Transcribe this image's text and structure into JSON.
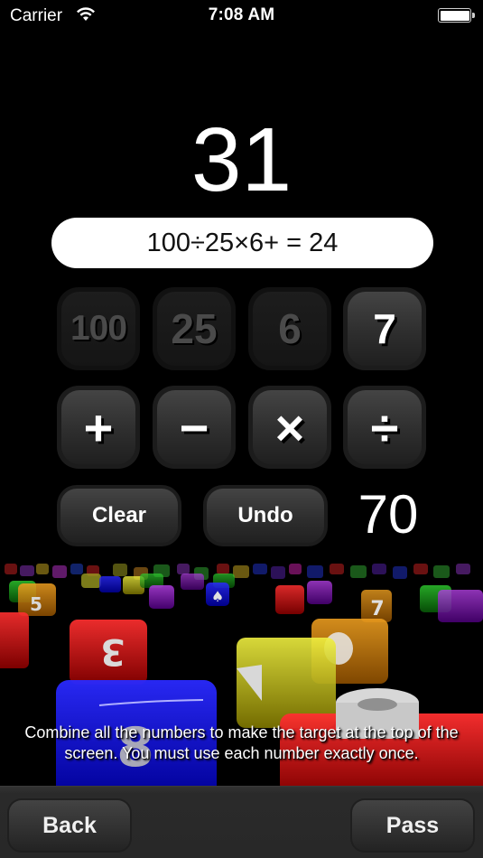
{
  "status_bar": {
    "carrier": "Carrier",
    "time": "7:08 AM",
    "wifi_icon": "wifi-icon",
    "battery_icon": "battery-full-icon"
  },
  "game": {
    "target": "31",
    "expression": "100÷25×6+ = 24",
    "number_tiles": [
      {
        "label": "100",
        "state": "used"
      },
      {
        "label": "25",
        "state": "used"
      },
      {
        "label": "6",
        "state": "used"
      },
      {
        "label": "7",
        "state": "available"
      }
    ],
    "operator_tiles": [
      {
        "label": "+",
        "icon": "plus-icon"
      },
      {
        "label": "−",
        "icon": "minus-icon"
      },
      {
        "label": "×",
        "icon": "multiply-icon"
      },
      {
        "label": "÷",
        "icon": "divide-icon"
      }
    ],
    "clear_label": "Clear",
    "undo_label": "Undo",
    "current_result": "70"
  },
  "instructions": "Combine all the numbers to make the target at the top of the screen. You must use each number exactly once.",
  "bottom_bar": {
    "back_label": "Back",
    "pass_label": "Pass"
  },
  "colors": {
    "background": "#000000",
    "tile_face": "#333333",
    "tile_used_text": "#4a4a4a",
    "expression_bg": "#ffffff",
    "bottom_bar": "#2a2a2a"
  }
}
